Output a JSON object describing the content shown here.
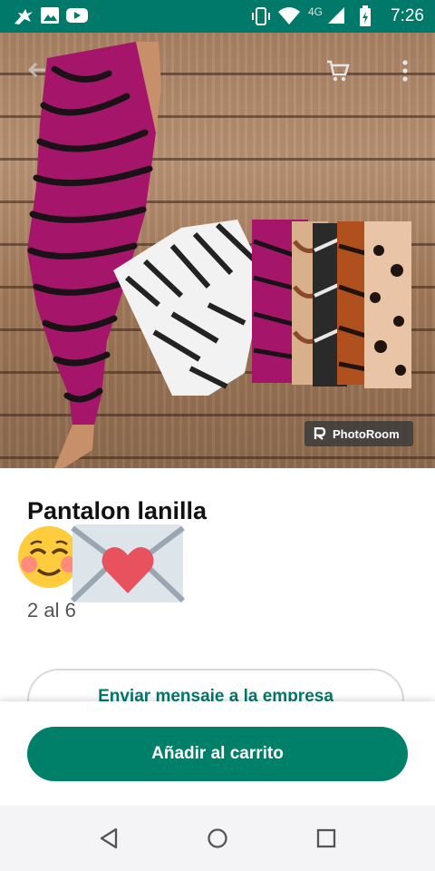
{
  "status_bar": {
    "time": "7:26",
    "network": "4G",
    "icons": [
      "bird-app-icon",
      "image-icon",
      "youtube-icon",
      "vibrate-icon",
      "wifi-icon",
      "signal-icon",
      "battery-icon"
    ]
  },
  "hero": {
    "toolbar_icons": [
      "back-arrow-icon",
      "cart-icon",
      "more-vert-icon"
    ],
    "watermark": "PhotoRoom"
  },
  "product": {
    "title": "Pantalon lanilla",
    "title_emojis": [
      "smiling-face-emoji",
      "love-letter-emoji"
    ],
    "description": "2 al 6"
  },
  "actions": {
    "message_business": "Enviar mensaje a la empresa",
    "add_to_cart": "Añadir al carrito"
  },
  "nav_bar": {
    "icons": [
      "back-triangle-icon",
      "home-circle-icon",
      "recents-square-icon"
    ]
  },
  "colors": {
    "accent": "#008069",
    "status_bar": "#00796b"
  }
}
